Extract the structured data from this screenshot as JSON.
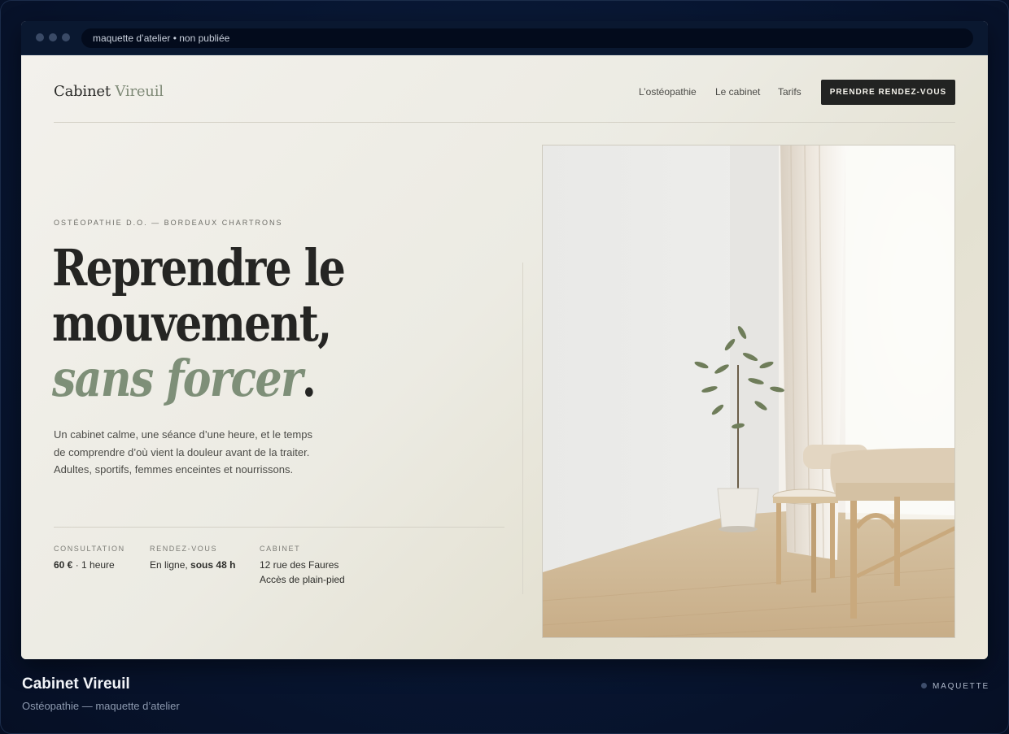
{
  "browser": {
    "url_text": "maquette d’atelier • non publiée"
  },
  "header": {
    "logo_primary": "Cabinet",
    "logo_accent": "Vireuil",
    "nav": [
      "L’ostéopathie",
      "Le cabinet",
      "Tarifs"
    ],
    "cta_label": "PRENDRE RENDEZ-VOUS"
  },
  "hero": {
    "eyebrow": "OSTÉOPATHIE D.O. — BORDEAUX CHARTRONS",
    "headline_line1": "Reprendre le",
    "headline_line2": "mouvement,",
    "headline_italic": "sans forcer",
    "headline_end": ".",
    "lede": "Un cabinet calme, une séance d’une heure, et le temps de comprendre d’où vient la douleur avant de la traiter. Adultes, sportifs, femmes enceintes et nourrissons."
  },
  "facts": [
    {
      "label": "CONSULTATION",
      "value_bold": "60 €",
      "value_rest": " · 1 heure"
    },
    {
      "label": "RENDEZ-VOUS",
      "value_rest": "En ligne, ",
      "value_bold": "sous 48 h"
    },
    {
      "label": "CABINET",
      "line1": "12 rue des Faures",
      "line2": "Accès de plain-pied"
    }
  ],
  "footer": {
    "title": "Cabinet Vireuil",
    "subtitle": "Ostéopathie — maquette d’atelier",
    "badge": "MAQUETTE"
  },
  "colors": {
    "accent_sage": "#7e8f78",
    "dark": "#222322",
    "background_navy": "#081632"
  }
}
